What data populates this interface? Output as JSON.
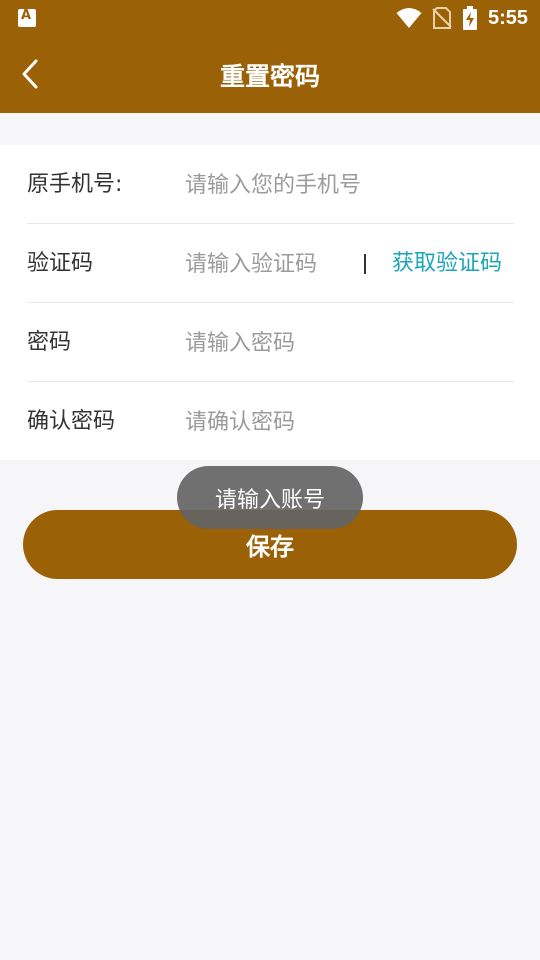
{
  "status_bar": {
    "app_icon": "a-letter-icon",
    "app_icon_letter": "A",
    "icons": [
      "wifi-icon",
      "no-sim-icon",
      "battery-charging-icon"
    ],
    "time": "5:55"
  },
  "app_bar": {
    "back_icon": "chevron-left-icon",
    "title": "重置密码"
  },
  "form": {
    "phone": {
      "label": "原手机号:",
      "placeholder": "请输入您的手机号",
      "value": ""
    },
    "code": {
      "label": "验证码",
      "placeholder": "请输入验证码",
      "value": "",
      "get_code_label": "获取验证码"
    },
    "password": {
      "label": "密码",
      "placeholder": "请输入密码",
      "value": ""
    },
    "confirm_password": {
      "label": "确认密码",
      "placeholder": "请确认密码",
      "value": ""
    }
  },
  "save_button": {
    "label": "保存"
  },
  "toast": {
    "message": "请输入账号"
  },
  "colors": {
    "brand": "#9a6106",
    "link": "#1aa6b7",
    "background": "#f6f6f8"
  }
}
